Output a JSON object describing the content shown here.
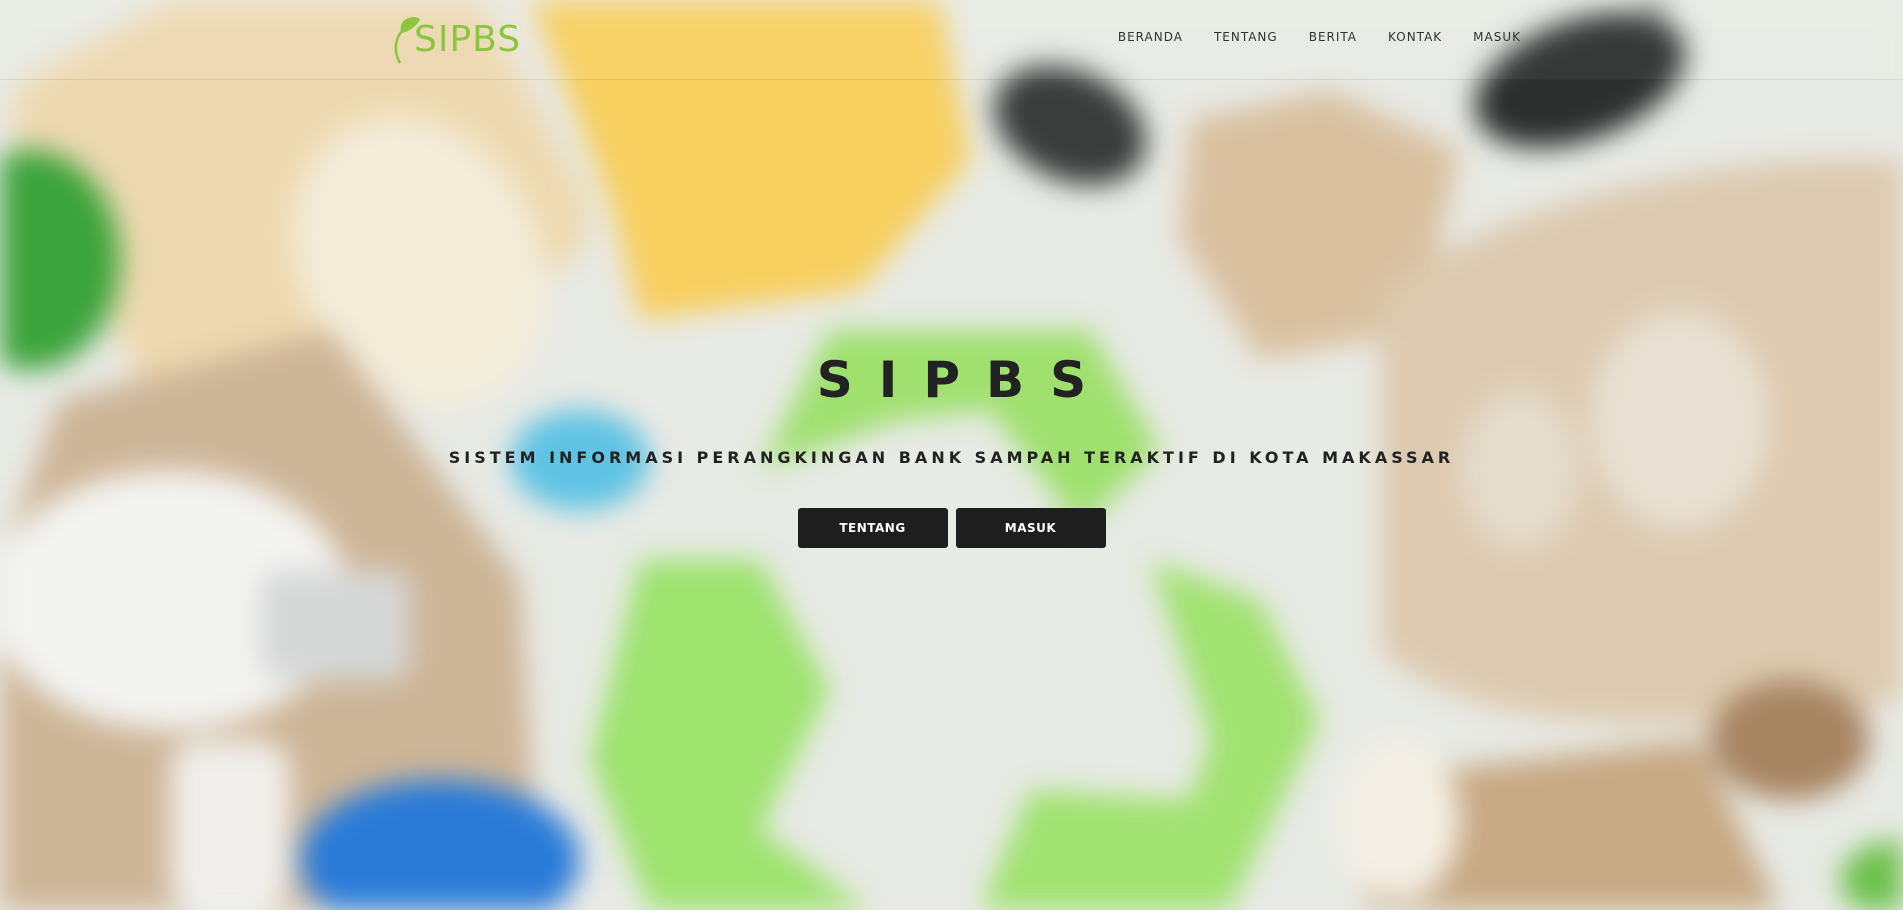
{
  "brand": {
    "name": "SIPBS",
    "logo_icon": "leaf-icon",
    "color": "#8cc63f"
  },
  "nav": {
    "items": [
      {
        "label": "BERANDA"
      },
      {
        "label": "TENTANG"
      },
      {
        "label": "BERITA"
      },
      {
        "label": "KONTAK"
      },
      {
        "label": "MASUK"
      }
    ]
  },
  "hero": {
    "title": "SIPBS",
    "subtitle": "SISTEM INFORMASI PERANGKINGAN BANK SAMPAH TERAKTIF DI KOTA MAKASSAR",
    "buttons": [
      {
        "label": "TENTANG"
      },
      {
        "label": "MASUK"
      }
    ],
    "background_icon": "recycle-icon"
  },
  "colors": {
    "accent": "#8cc63f",
    "button_bg": "#1e1e1e",
    "text": "#222222"
  }
}
